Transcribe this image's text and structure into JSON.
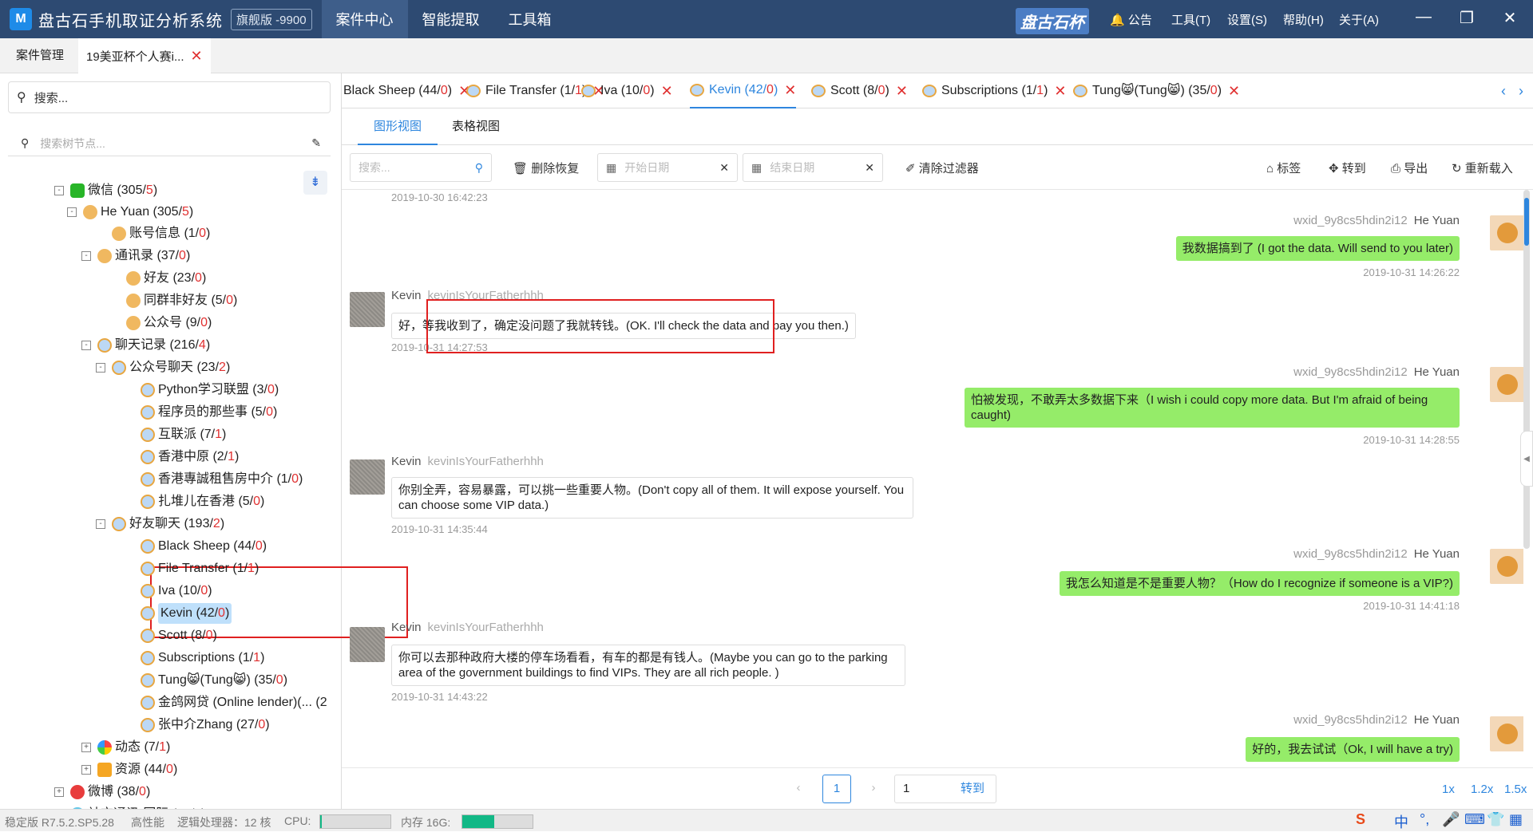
{
  "titlebar": {
    "app_name": "盘古石手机取证分析系统",
    "edition": "旗舰版 -9900",
    "nav": [
      "案件中心",
      "智能提取",
      "工具箱"
    ],
    "brand": "盘古石杯",
    "announce": "公告",
    "menus": [
      "工具(T)",
      "设置(S)",
      "帮助(H)",
      "关于(A)"
    ]
  },
  "casebar": {
    "tab1": "案件管理",
    "tab2": "19美亚杯个人赛i..."
  },
  "left": {
    "search_placeholder": "搜索...",
    "tree_search_placeholder": "搜索树节点...",
    "tree": [
      {
        "label": "微信",
        "a": "305",
        "b": "5"
      },
      {
        "label": "He Yuan",
        "a": "305",
        "b": "5"
      },
      {
        "label": "账号信息",
        "a": "1",
        "b": "0"
      },
      {
        "label": "通讯录",
        "a": "37",
        "b": "0"
      },
      {
        "label": "好友",
        "a": "23",
        "b": "0"
      },
      {
        "label": "同群非好友",
        "a": "5",
        "b": "0"
      },
      {
        "label": "公众号",
        "a": "9",
        "b": "0"
      },
      {
        "label": "聊天记录",
        "a": "216",
        "b": "4"
      },
      {
        "label": "公众号聊天",
        "a": "23",
        "b": "2"
      },
      {
        "label": "Python学习联盟",
        "a": "3",
        "b": "0"
      },
      {
        "label": "程序员的那些事",
        "a": "5",
        "b": "0"
      },
      {
        "label": "互联派",
        "a": "7",
        "b": "1"
      },
      {
        "label": "香港中原",
        "a": "2",
        "b": "1"
      },
      {
        "label": "香港專誠租售房中介",
        "a": "1",
        "b": "0"
      },
      {
        "label": "扎堆儿在香港",
        "a": "5",
        "b": "0"
      },
      {
        "label": "好友聊天",
        "a": "193",
        "b": "2"
      },
      {
        "label": "Black Sheep",
        "a": "44",
        "b": "0"
      },
      {
        "label": "File Transfer",
        "a": "1",
        "b": "1"
      },
      {
        "label": "Iva",
        "a": "10",
        "b": "0"
      },
      {
        "label": "Kevin",
        "a": "42",
        "b": "0"
      },
      {
        "label": "Scott",
        "a": "8",
        "b": "0"
      },
      {
        "label": "Subscriptions",
        "a": "1",
        "b": "1"
      },
      {
        "label": "Tung😸(Tung😸)",
        "a": "35",
        "b": "0"
      },
      {
        "label": "金鸽网贷 (Online lender)(... (2",
        "a": "",
        "b": ""
      },
      {
        "label": "张中介Zhang",
        "a": "27",
        "b": "0"
      },
      {
        "label": "动态",
        "a": "7",
        "b": "1"
      },
      {
        "label": "资源",
        "a": "44",
        "b": "0"
      },
      {
        "label": "微博",
        "a": "38",
        "b": "0"
      },
      {
        "label": "社交通讯-国际",
        "a": "40",
        "b": "0"
      }
    ]
  },
  "chat_tabs": [
    {
      "name": "Black Sheep",
      "a": "44",
      "b": "0"
    },
    {
      "name": "File Transfer",
      "a": "1",
      "b": "1"
    },
    {
      "name": "Iva",
      "a": "10",
      "b": "0"
    },
    {
      "name": "Kevin",
      "a": "42",
      "b": "0"
    },
    {
      "name": "Scott",
      "a": "8",
      "b": "0"
    },
    {
      "name": "Subscriptions",
      "a": "1",
      "b": "1"
    },
    {
      "name": "Tung😸(Tung😸)",
      "a": "35",
      "b": "0"
    }
  ],
  "view_tabs": [
    "图形视图",
    "表格视图"
  ],
  "toolbar": {
    "search_placeholder": "搜索...",
    "delete_restore": "删除恢复",
    "start_date": "开始日期",
    "end_date": "结束日期",
    "clear_filter": "清除过滤器",
    "tag": "标签",
    "goto": "转到",
    "export": "导出",
    "reload": "重新载入"
  },
  "messages": {
    "top_ts": "2019-10-30 16:42:23",
    "me_name": "He Yuan",
    "me_id": "wxid_9y8cs5hdin2i12",
    "other_name": "Kevin",
    "other_id": "kevinIsYourFatherhhh",
    "m1": {
      "text": "我数据搞到了 (I got the data. Will send to you later)",
      "ts": "2019-10-31 14:26:22"
    },
    "m2": {
      "text": "好，等我收到了，确定没问题了我就转钱。(OK. I'll check the data and pay you then.)",
      "ts": "2019-10-31 14:27:53"
    },
    "m3": {
      "text": "怕被发现，不敢弄太多数据下来（I wish i could copy more data. But I'm afraid of being caught)",
      "ts": "2019-10-31 14:28:55"
    },
    "m4": {
      "text": "你别全弄，容易暴露，可以挑一些重要人物。(Don't copy all of them. It will expose yourself. You can choose some VIP data.)",
      "ts": "2019-10-31 14:35:44"
    },
    "m5": {
      "text": "我怎么知道是不是重要人物？（How do I recognize if someone is a VIP?)",
      "ts": "2019-10-31 14:41:18"
    },
    "m6": {
      "text": "你可以去那种政府大楼的停车场看看，有车的都是有钱人。(Maybe you can go to the parking area of the government  buildings to find VIPs. They are all rich people. )",
      "ts": "2019-10-31 14:43:22"
    },
    "m7": {
      "text": "好的，我去试试（Ok, I will have a try)",
      "ts": ""
    }
  },
  "pager": {
    "current": "1",
    "goto_value": "1",
    "goto_label": "转到",
    "zooms": [
      "1x",
      "1.2x",
      "1.5x"
    ]
  },
  "status": {
    "version": "稳定版  R7.5.2.SP5.28",
    "perf": "高性能",
    "cpu_cores": "逻辑处理器：12 核",
    "cpu_label": "CPU:",
    "mem_label": "内存 16G:",
    "cpu_fraction": 0.02,
    "mem_fraction": 0.45,
    "ime": "中"
  },
  "colors": {
    "accent": "#2e86de",
    "title_bg": "#2d4a72",
    "bubble_out": "#95ec69",
    "highlight_box": "#e02020"
  }
}
